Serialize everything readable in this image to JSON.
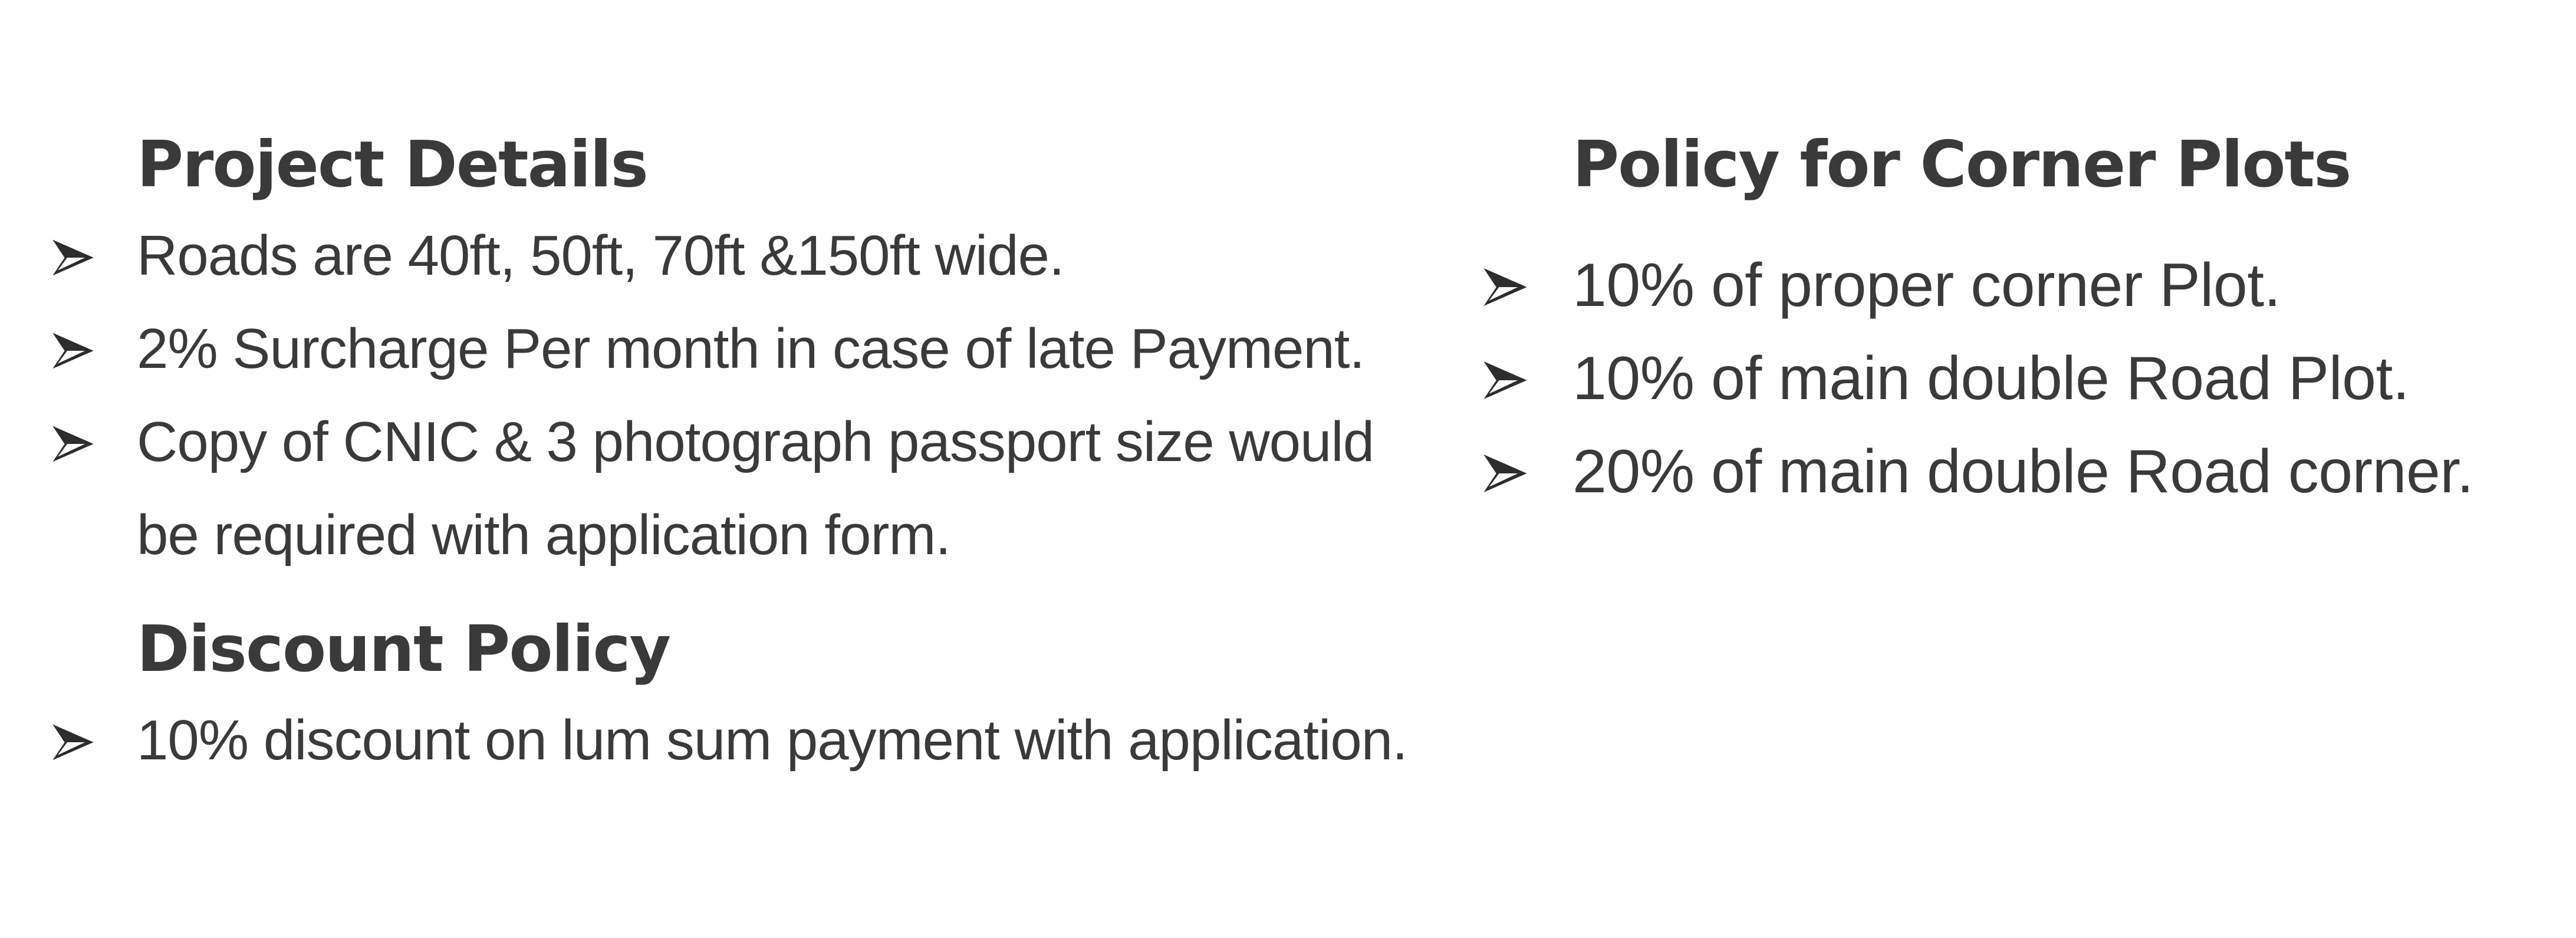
{
  "project": {
    "heading": "Project Details",
    "items": [
      "Roads are 40ft, 50ft, 70ft &150ft wide.",
      "2% Surcharge Per month in case of late Payment.",
      "Copy of CNIC & 3 photograph passport size would be required with application form."
    ]
  },
  "discount": {
    "heading": "Discount Policy",
    "items": [
      "10% discount on lum sum payment with application."
    ]
  },
  "corner": {
    "heading": "Policy for Corner Plots",
    "items": [
      "10% of proper corner Plot.",
      "10% of main double Road Plot.",
      "20% of main double Road corner."
    ]
  },
  "icons": {
    "bullet": "arrowhead-bullet-icon"
  },
  "colors": {
    "text": "#3b3a3b",
    "background": "#ffffff"
  }
}
